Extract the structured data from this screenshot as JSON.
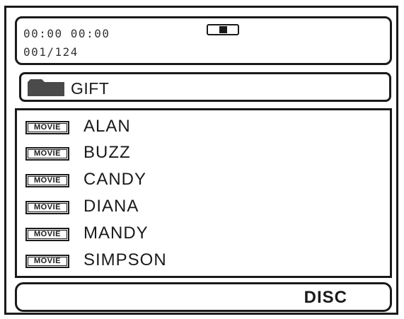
{
  "status": {
    "time": "00:00 00:00",
    "track": "001/124",
    "mode_icon": "playback-mode-icon"
  },
  "folder": {
    "icon": "folder-icon",
    "name": "GIFT"
  },
  "files": [
    {
      "badge": "MOVIE",
      "name": "ALAN"
    },
    {
      "badge": "MOVIE",
      "name": "BUZZ"
    },
    {
      "badge": "MOVIE",
      "name": "CANDY"
    },
    {
      "badge": "MOVIE",
      "name": "DIANA"
    },
    {
      "badge": "MOVIE",
      "name": "MANDY"
    },
    {
      "badge": "MOVIE",
      "name": "SIMPSON"
    }
  ],
  "source": {
    "label": "DISC"
  }
}
